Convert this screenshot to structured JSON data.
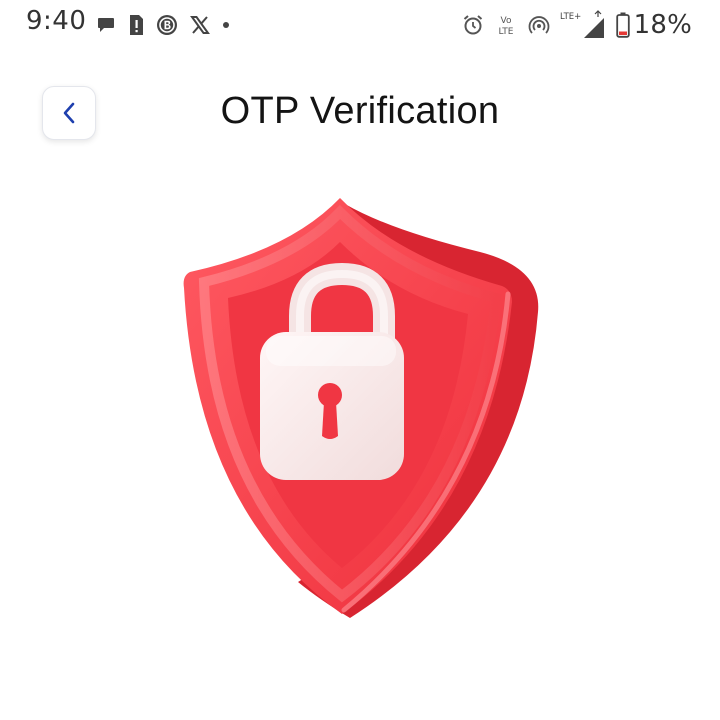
{
  "status_bar": {
    "time": "9:40",
    "battery_percent": "18%",
    "volte_line1": "Vo",
    "volte_line2": "LTE",
    "signal_type": "LTE+",
    "left_icons": [
      "message-icon",
      "sim-alert-icon",
      "b-circle-icon",
      "x-logo-icon",
      "dot-icon"
    ],
    "right_icons": [
      "alarm-icon",
      "volte-icon",
      "hotspot-icon",
      "signal-icon",
      "battery-icon"
    ]
  },
  "header": {
    "title": "OTP Verification",
    "back_icon": "chevron-left-icon"
  },
  "illustration": {
    "icon": "shield-lock-icon"
  },
  "colors": {
    "shield_red": "#f2404a",
    "shield_highlight": "#ff7a80",
    "lock_white": "#f7e9e9",
    "back_chevron": "#1e3fae",
    "title_text": "#141414"
  }
}
